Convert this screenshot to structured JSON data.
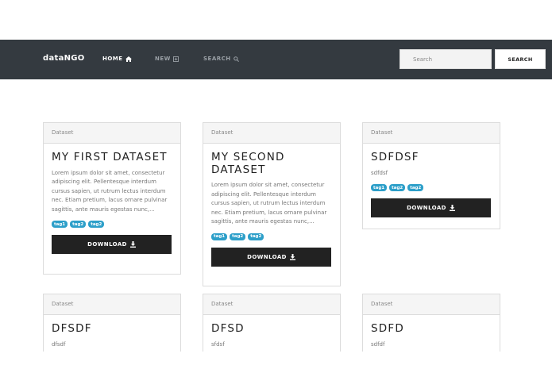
{
  "navbar": {
    "brand": "dataNGO",
    "links": [
      {
        "label": "HOME",
        "icon": "home-icon"
      },
      {
        "label": "NEW",
        "icon": "plus-square-icon"
      },
      {
        "label": "SEARCH",
        "icon": "search-icon"
      }
    ],
    "search_placeholder": "Search",
    "search_button": "SEARCH"
  },
  "cards": [
    {
      "header": "Dataset",
      "title": "MY FIRST DATASET",
      "description": "Lorem ipsum dolor sit amet, consectetur adipiscing elit. Pellentesque interdum cursus sapien, ut rutrum lectus interdum nec. Etiam pretium, lacus ornare pulvinar sagittis, ante mauris egestas nunc,...",
      "tags": [
        "tag1",
        "tag2",
        "tag2"
      ],
      "button": "DOWNLOAD"
    },
    {
      "header": "Dataset",
      "title": "MY SECOND DATASET",
      "description": "Lorem ipsum dolor sit amet, consectetur adipiscing elit. Pellentesque interdum cursus sapien, ut rutrum lectus interdum nec. Etiam pretium, lacus ornare pulvinar sagittis, ante mauris egestas nunc,...",
      "tags": [
        "tag1",
        "tag2",
        "tag2"
      ],
      "button": "DOWNLOAD"
    },
    {
      "header": "Dataset",
      "title": "SDFDSF",
      "description": "sdfdsf",
      "tags": [
        "tag1",
        "tag2",
        "tag2"
      ],
      "button": "DOWNLOAD"
    },
    {
      "header": "Dataset",
      "title": "DFSDF",
      "description": "dfsdf"
    },
    {
      "header": "Dataset",
      "title": "DFSD",
      "description": "sfdsf"
    },
    {
      "header": "Dataset",
      "title": "SDFD",
      "description": "sdfdf"
    }
  ],
  "colors": {
    "navbar_bg": "#343a40",
    "tag_bg": "#2d9fc9",
    "button_bg": "#222222"
  }
}
